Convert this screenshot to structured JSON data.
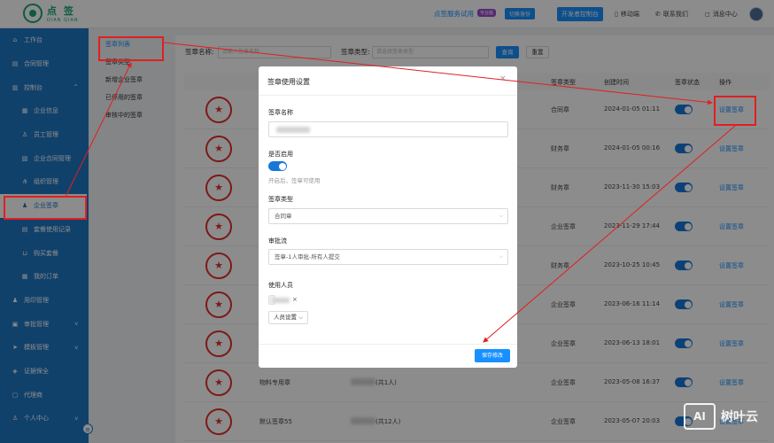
{
  "header": {
    "logo_cn": "点 签",
    "logo_en": "DIAN QIAN",
    "service_text": "点签服务试用",
    "pro_badge": "专业版",
    "switch_label": "切换身份",
    "console_label": "开发者控制台",
    "links": [
      {
        "icon": "mobile-icon",
        "glyph": "▯",
        "label": "移动端"
      },
      {
        "icon": "phone-icon",
        "glyph": "✆",
        "label": "联系我们"
      },
      {
        "icon": "message-icon",
        "glyph": "◻",
        "label": "消息中心"
      }
    ]
  },
  "sidebar": {
    "items": [
      {
        "label": "工作台",
        "icon": "home-icon",
        "glyph": "⌂",
        "sub": false
      },
      {
        "label": "合同管理",
        "icon": "contract-icon",
        "glyph": "▤",
        "sub": false
      },
      {
        "label": "控制台",
        "icon": "chart-icon",
        "glyph": "▥",
        "sub": false,
        "arrow": "^"
      },
      {
        "label": "企业信息",
        "icon": "building-icon",
        "glyph": "▦",
        "sub": true
      },
      {
        "label": "员工管理",
        "icon": "user-icon",
        "glyph": "♙",
        "sub": true
      },
      {
        "label": "企业合同管理",
        "icon": "file-icon",
        "glyph": "▧",
        "sub": true
      },
      {
        "label": "组织管理",
        "icon": "org-icon",
        "glyph": "⋔",
        "sub": true
      },
      {
        "label": "企业签章",
        "icon": "seal-icon",
        "glyph": "♟",
        "sub": true,
        "active": true
      },
      {
        "label": "套餐使用记录",
        "icon": "record-icon",
        "glyph": "▤",
        "sub": true
      },
      {
        "label": "购买套餐",
        "icon": "cart-icon",
        "glyph": "⊔",
        "sub": true
      },
      {
        "label": "我的订单",
        "icon": "order-icon",
        "glyph": "▦",
        "sub": true
      },
      {
        "label": "用印管理",
        "icon": "stamp-icon",
        "glyph": "♟",
        "sub": false
      },
      {
        "label": "审批管理",
        "icon": "approval-icon",
        "glyph": "▣",
        "sub": false,
        "arrow": "v"
      },
      {
        "label": "模板管理",
        "icon": "template-icon",
        "glyph": "➤",
        "sub": false,
        "arrow": "v"
      },
      {
        "label": "证据保全",
        "icon": "shield-icon",
        "glyph": "◈",
        "sub": false
      },
      {
        "label": "代理商",
        "icon": "agent-icon",
        "glyph": "▢",
        "sub": false
      },
      {
        "label": "个人中心",
        "icon": "person-icon",
        "glyph": "♙",
        "sub": false,
        "arrow": "v"
      }
    ],
    "collapse_glyph": "≡"
  },
  "subnav": {
    "items": [
      "签章列表",
      "签章类型",
      "新增企业签章",
      "已停用的签章",
      "审核中的签章"
    ]
  },
  "filters": {
    "name_label": "签章名称:",
    "name_placeholder": "请输入签章名称",
    "type_label": "签章类型:",
    "type_placeholder": "请选择签章类型",
    "query_label": "查询",
    "reset_label": "重置"
  },
  "table": {
    "headers": {
      "type": "签章类型",
      "created": "创建时间",
      "status": "签章状态",
      "ops": "操作"
    },
    "rows": [
      {
        "name": "",
        "users": "",
        "type": "合同章",
        "created": "2024-01-05 01:11",
        "op": "设置签章"
      },
      {
        "name": "",
        "users": "",
        "type": "财务章",
        "created": "2024-01-05 00:16",
        "op": "设置签章"
      },
      {
        "name": "",
        "users": "",
        "type": "财务章",
        "created": "2023-11-30 15:03",
        "op": "设置签章"
      },
      {
        "name": "",
        "users": "",
        "type": "企业签章",
        "created": "2023-11-29 17:44",
        "op": "设置签章"
      },
      {
        "name": "",
        "users": "",
        "type": "财务章",
        "created": "2023-10-25 10:45",
        "op": "设置签章"
      },
      {
        "name": "",
        "users": "",
        "type": "企业签章",
        "created": "2023-06-16 11:14",
        "op": "设置签章"
      },
      {
        "name": "",
        "users": "",
        "type": "企业签章",
        "created": "2023-06-13 18:01",
        "op": "设置签章"
      },
      {
        "name": "物料专用章",
        "users": "(共1人)",
        "type": "企业签章",
        "created": "2023-05-08 16:37",
        "op": "设置签章"
      },
      {
        "name": "默认签章55",
        "users": "(共12人)",
        "type": "企业签章",
        "created": "2023-05-07 20:03",
        "op": "设置签章"
      }
    ],
    "seal_glyph": "★"
  },
  "modal": {
    "title": "签章使用设置",
    "close": "×",
    "name_label": "签章名称",
    "enable_label": "是否启用",
    "enable_on": true,
    "enable_hint": "开启后，签章可使用",
    "type_label": "签章类型",
    "type_value": "合同章",
    "flow_label": "审批流",
    "flow_value": "签章-1人审批-所有人提交",
    "users_label": "使用人员",
    "tag_close": "×",
    "person_select": "人员设置",
    "save_label": "保存修改"
  },
  "watermark": {
    "mark": "AI",
    "text": "树叶云"
  },
  "annotation_color": "#e02020"
}
